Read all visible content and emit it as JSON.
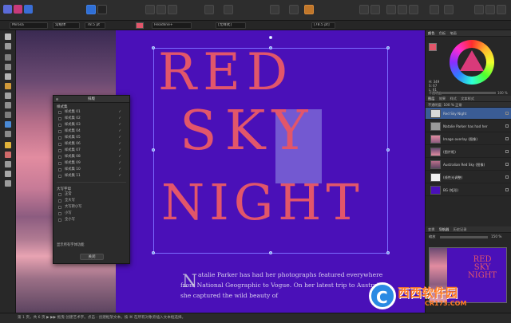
{
  "context": {
    "font_name": "Mirosa",
    "font_style": "常规体",
    "font_size": "78.5 pt",
    "style_preset": "Headline+",
    "para_style": "[无样式]",
    "leading": "[78.5 pt]"
  },
  "poster": {
    "line1": "RED",
    "line2": "SKY",
    "line3": "NIGHT",
    "body_dropcap": "N",
    "body_text": "atalie Parker has had her photographs featured everywhere from National Geographic to Vogue. On her latest trip to Australia, she captured the wild beauty of"
  },
  "dialog": {
    "title": "排版",
    "section_styles": "样式集",
    "styles": [
      "样式集 01",
      "样式集 02",
      "样式集 03",
      "样式集 04",
      "样式集 05",
      "样式集 06",
      "样式集 07",
      "样式集 08",
      "样式集 09",
      "样式集 10",
      "样式集 11"
    ],
    "section_case": "大写字母",
    "cases": [
      "正常",
      "全大写",
      "大写转小写",
      "小写",
      "全小写"
    ],
    "show_all": "显示所有字体功能",
    "close_label": "关闭"
  },
  "right_panel": {
    "color_tabs": [
      "颜色",
      "色板",
      "笔画"
    ],
    "hsl_h": "H: 349",
    "hsl_s": "S: 67",
    "hsl_l": "L: 61",
    "opacity_label": "不透明度",
    "opacity_value": "100 %",
    "layer_tabs": [
      "图层",
      "效果",
      "样式",
      "文本样式"
    ],
    "layer_opts": "不透明度: 100 %  正常",
    "layers": [
      "Red Sky Night",
      "Natalie Parker has had her",
      "Image overlay (图像)",
      "(图片框)",
      "Australian Red Sky (图像)",
      "(线性光调整)",
      "BG (矩形)"
    ],
    "nav_tabs": [
      "变换",
      "导航器",
      "历史记录"
    ],
    "zoom_label": "缩放",
    "zoom_value": "150 %"
  },
  "status": {
    "text": "第 1 页，共 6 页   ▶ ▶▶  拖曳 创建艺术字。点击 - 创建框架文本。按 ⌘ 在所有对象旁插入文本框选择。"
  },
  "watermark": {
    "brand": "西西软件园",
    "url": "CR173.COM"
  }
}
